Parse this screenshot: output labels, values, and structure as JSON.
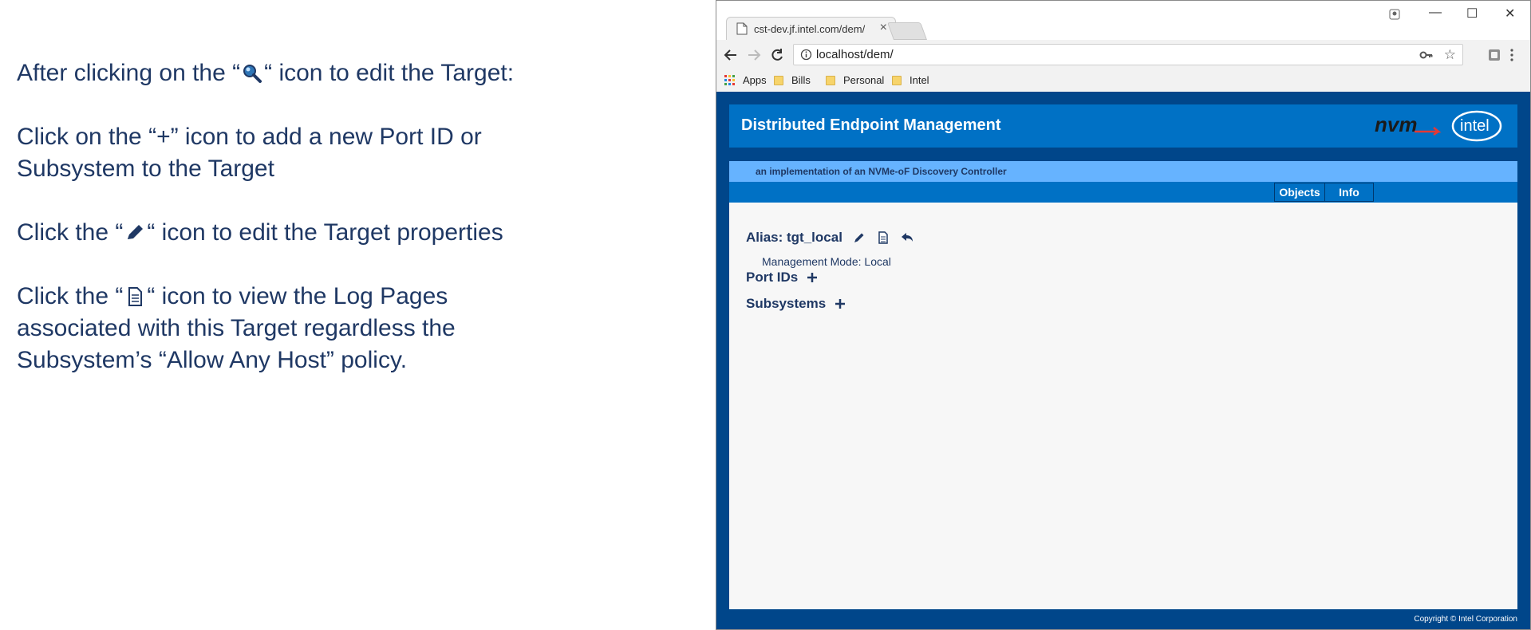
{
  "instructions": {
    "p1_before": "After clicking on the “",
    "p1_after": "“ icon to edit the Target:",
    "p2_line1": "Click on the “+” icon to add a new Port ID or",
    "p2_line2": "Subsystem to the Target",
    "p3_before": "Click the “",
    "p3_after": "“ icon to edit the Target properties",
    "p4_before": "Click the “",
    "p4_after": "“ icon to view the Log Pages",
    "p4_line2": "associated with this Target regardless the",
    "p4_line3": "Subsystem’s “Allow Any Host” policy."
  },
  "browser": {
    "tab_title": "cst-dev.jf.intel.com/dem/",
    "tab_close": "×",
    "url": "localhost/dem/",
    "window_controls": {
      "minimize": "—",
      "maximize": "☐",
      "close": "✕"
    },
    "bookmarks": [
      "Apps",
      "Bills",
      "Personal",
      "Intel"
    ]
  },
  "app": {
    "title": "Distributed Endpoint Management",
    "nvm_logo_text": "nvm",
    "intel_logo_text": "intel",
    "subtitle": "an implementation of an NVMe-oF Discovery Controller",
    "menu": [
      "Objects",
      "Info"
    ],
    "alias": "Alias: tgt_local",
    "management_mode": "Management Mode: Local",
    "sections": [
      "Port IDs",
      "Subsystems"
    ],
    "footer": "Copyright © Intel Corporation"
  },
  "colors": {
    "page_bg": "#00468a",
    "header_blue": "#0071c5",
    "subheader_blue": "#66b3ff",
    "text_navy": "#1f3864"
  },
  "icons": [
    "magnifier-icon",
    "pencil-icon",
    "document-icon",
    "undo-arrow-icon",
    "plus-icon"
  ]
}
